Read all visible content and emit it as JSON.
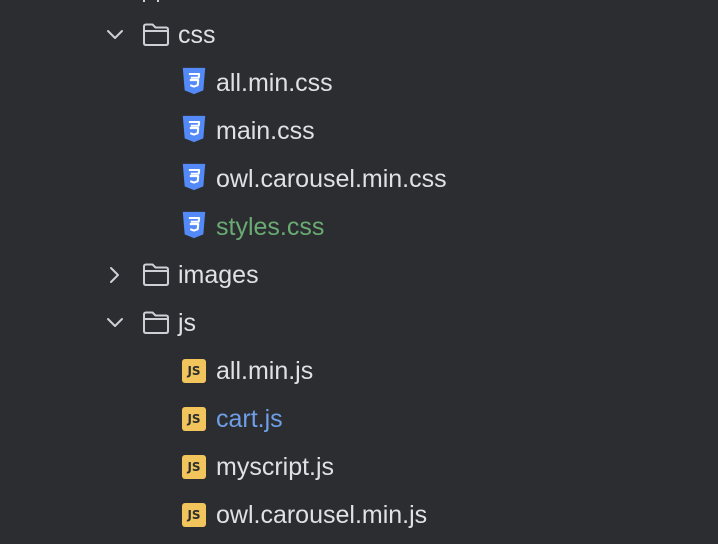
{
  "colors": {
    "background": "#2b2d30",
    "text": "#dfe1e5",
    "modified_text": "#6aab73",
    "new_vcs_text": "#6f9fe8",
    "css_icon": "#548af7",
    "js_icon": "#f2c55c",
    "folder_outline": "#ced0d6",
    "chevron": "#ced0d6"
  },
  "tree": {
    "css_folder": {
      "name": "css",
      "expanded": true,
      "icon": "folder-icon"
    },
    "css_files": [
      {
        "name": "all.min.css",
        "icon": "css-file-icon"
      },
      {
        "name": "main.css",
        "icon": "css-file-icon"
      },
      {
        "name": "owl.carousel.min.css",
        "icon": "css-file-icon"
      },
      {
        "name": "styles.css",
        "icon": "css-file-icon",
        "vcs_status": "added"
      }
    ],
    "images_folder": {
      "name": "images",
      "expanded": false,
      "icon": "folder-icon"
    },
    "js_folder": {
      "name": "js",
      "expanded": true,
      "icon": "folder-icon"
    },
    "js_files": [
      {
        "name": "all.min.js",
        "icon": "js-file-icon",
        "badge": "JS"
      },
      {
        "name": "cart.js",
        "icon": "js-file-icon",
        "badge": "JS",
        "vcs_status": "modified"
      },
      {
        "name": "myscript.js",
        "icon": "js-file-icon",
        "badge": "JS"
      },
      {
        "name": "owl.carousel.min.js",
        "icon": "js-file-icon",
        "badge": "JS"
      }
    ]
  }
}
